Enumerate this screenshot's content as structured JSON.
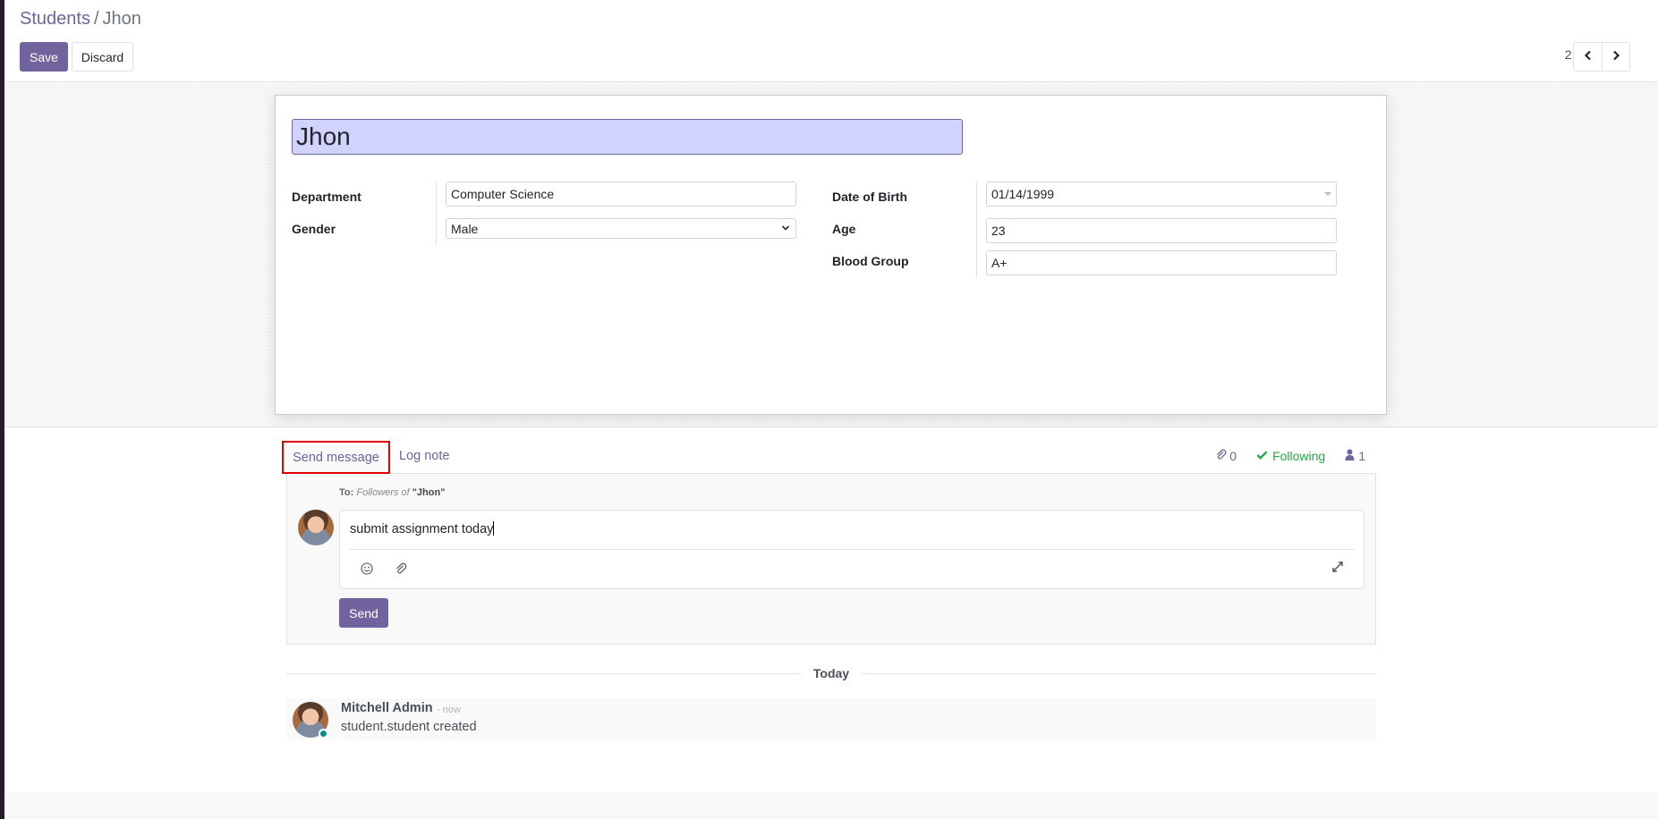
{
  "breadcrumb": {
    "parent": "Students",
    "separator": "/",
    "current": "Jhon"
  },
  "toolbar": {
    "save_label": "Save",
    "discard_label": "Discard"
  },
  "pager": {
    "value": "2 / 2",
    "prev_icon": "chevron-left-icon",
    "next_icon": "chevron-right-icon"
  },
  "form": {
    "name": "Jhon",
    "left_fields": [
      {
        "label": "Department",
        "value": "Computer Science",
        "type": "text"
      },
      {
        "label": "Gender",
        "value": "Male",
        "type": "select"
      }
    ],
    "right_fields": [
      {
        "label": "Date of Birth",
        "value": "01/14/1999",
        "type": "date"
      },
      {
        "label": "Age",
        "value": "23",
        "type": "text"
      },
      {
        "label": "Blood Group",
        "value": "A+",
        "type": "text"
      }
    ]
  },
  "chatter": {
    "tabs": {
      "send_message": "Send message",
      "log_note": "Log note"
    },
    "attachments_count": "0",
    "following_label": "Following",
    "followers_count": "1",
    "composer": {
      "to_prefix": "To:",
      "to_followers": "Followers of",
      "to_record": "\"Jhon\"",
      "text": "submit assignment today",
      "send_label": "Send",
      "icons": [
        "emoji-icon",
        "paperclip-icon",
        "expand-icon"
      ]
    },
    "date_separator": "Today",
    "messages": [
      {
        "author": "Mitchell Admin",
        "date": "- now",
        "body": "student.student created"
      }
    ]
  },
  "colors": {
    "brand": "#71639e",
    "name_field_bg": "#d2d2ff",
    "following": "#28a745",
    "highlight_box": "#e00000",
    "online": "#0b8c84"
  }
}
